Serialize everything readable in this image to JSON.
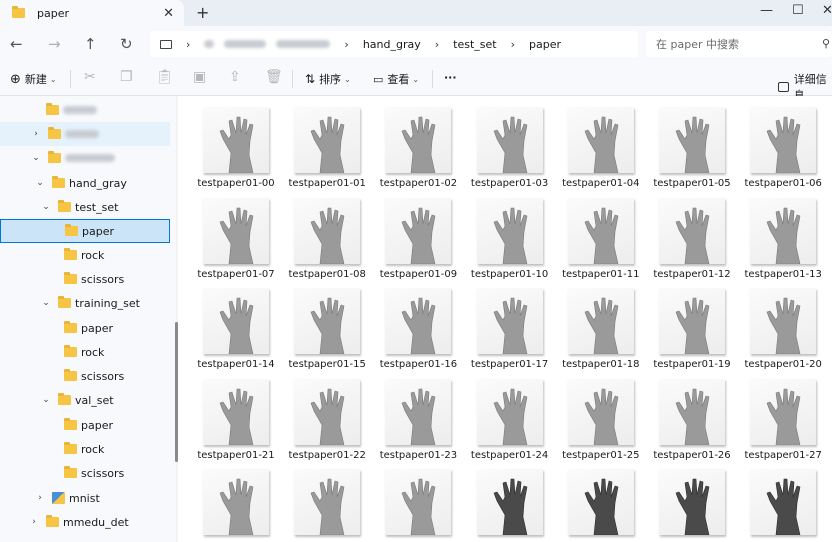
{
  "window": {
    "tab_title": "paper",
    "new_tab_label": "+",
    "minimize": "—",
    "maximize": "☐",
    "close": "✕"
  },
  "nav": {
    "back": "←",
    "forward": "→",
    "up": "↑",
    "refresh": "↻",
    "crumb_hand_gray": "hand_gray",
    "crumb_test_set": "test_set",
    "crumb_paper": "paper",
    "search_placeholder": "在 paper 中搜索"
  },
  "toolbar": {
    "new_label": "新建",
    "sort_label": "排序",
    "view_label": "查看",
    "more_label": "···",
    "details_label": "详细信息"
  },
  "sidebar": {
    "hand_gray": "hand_gray",
    "test_set": "test_set",
    "test_paper": "paper",
    "test_rock": "rock",
    "test_scissors": "scissors",
    "training_set": "training_set",
    "training_paper": "paper",
    "training_rock": "rock",
    "training_scissors": "scissors",
    "val_set": "val_set",
    "val_paper": "paper",
    "val_rock": "rock",
    "val_scissors": "scissors",
    "mnist": "mnist",
    "mmedu_det": "mmedu_det"
  },
  "files": [
    {
      "name": "testpaper01-00",
      "tone": "gray"
    },
    {
      "name": "testpaper01-01",
      "tone": "gray"
    },
    {
      "name": "testpaper01-02",
      "tone": "gray"
    },
    {
      "name": "testpaper01-03",
      "tone": "gray"
    },
    {
      "name": "testpaper01-04",
      "tone": "gray"
    },
    {
      "name": "testpaper01-05",
      "tone": "gray"
    },
    {
      "name": "testpaper01-06",
      "tone": "gray"
    },
    {
      "name": "testpaper01-07",
      "tone": "gray"
    },
    {
      "name": "testpaper01-08",
      "tone": "gray"
    },
    {
      "name": "testpaper01-09",
      "tone": "gray"
    },
    {
      "name": "testpaper01-10",
      "tone": "gray"
    },
    {
      "name": "testpaper01-11",
      "tone": "gray"
    },
    {
      "name": "testpaper01-12",
      "tone": "gray"
    },
    {
      "name": "testpaper01-13",
      "tone": "gray"
    },
    {
      "name": "testpaper01-14",
      "tone": "gray"
    },
    {
      "name": "testpaper01-15",
      "tone": "gray"
    },
    {
      "name": "testpaper01-16",
      "tone": "gray"
    },
    {
      "name": "testpaper01-17",
      "tone": "gray"
    },
    {
      "name": "testpaper01-18",
      "tone": "gray"
    },
    {
      "name": "testpaper01-19",
      "tone": "gray"
    },
    {
      "name": "testpaper01-20",
      "tone": "gray"
    },
    {
      "name": "testpaper01-21",
      "tone": "gray"
    },
    {
      "name": "testpaper01-22",
      "tone": "gray"
    },
    {
      "name": "testpaper01-23",
      "tone": "gray"
    },
    {
      "name": "testpaper01-24",
      "tone": "gray"
    },
    {
      "name": "testpaper01-25",
      "tone": "gray"
    },
    {
      "name": "testpaper01-26",
      "tone": "gray"
    },
    {
      "name": "testpaper01-27",
      "tone": "gray"
    },
    {
      "name": "",
      "tone": "gray"
    },
    {
      "name": "",
      "tone": "gray"
    },
    {
      "name": "",
      "tone": "gray"
    },
    {
      "name": "",
      "tone": "dark"
    },
    {
      "name": "",
      "tone": "dark"
    },
    {
      "name": "",
      "tone": "dark"
    },
    {
      "name": "",
      "tone": "dark"
    }
  ],
  "colors": {
    "selection": "#cce4f7",
    "accent": "#0078d4",
    "folder": "#f5c543"
  }
}
